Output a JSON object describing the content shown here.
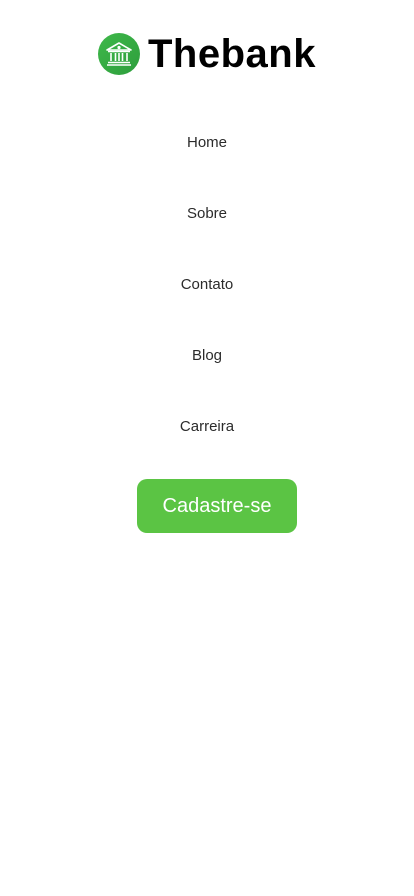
{
  "brand": {
    "name": "Thebank",
    "icon": "bank-building-icon",
    "color": "#3fb84a"
  },
  "nav": {
    "items": [
      {
        "label": "Home"
      },
      {
        "label": "Sobre"
      },
      {
        "label": "Contato"
      },
      {
        "label": "Blog"
      },
      {
        "label": "Carreira"
      }
    ]
  },
  "cta": {
    "label": "Cadastre-se",
    "color": "#5bc444"
  }
}
